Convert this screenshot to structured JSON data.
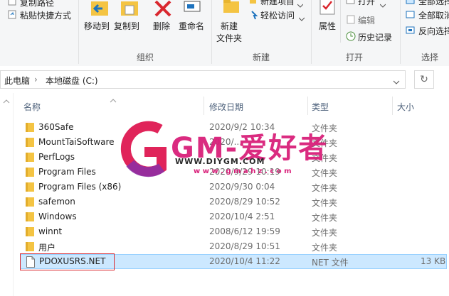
{
  "ribbon": {
    "copy_path": "复制路径",
    "paste_shortcut": "粘贴快捷方式",
    "move_to": "移动到",
    "copy_to": "复制到",
    "delete": "删除",
    "rename": "重命名",
    "new_folder_line1": "新建",
    "new_folder_line2": "文件夹",
    "new_item": "新建项目",
    "easy_access": "轻松访问",
    "properties": "属性",
    "open": "打开",
    "edit": "编辑",
    "history": "历史记录",
    "select_all": "全部选择",
    "select_none": "全部取消",
    "invert_selection": "反向选择",
    "groups": {
      "organize": "组织",
      "new": "新建",
      "open": "打开",
      "select": "选择"
    }
  },
  "address": {
    "root": "此电脑",
    "separator": "›",
    "current": "本地磁盘 (C:)"
  },
  "columns": {
    "name": "名称",
    "modified": "修改日期",
    "type": "类型",
    "size": "大小"
  },
  "files": [
    {
      "name": "360Safe",
      "modified": "2020/9/2 10:34",
      "type": "文件夹",
      "size": ""
    },
    {
      "name": "MountTaiSoftware",
      "modified": "2020/...",
      "type": "文件夹",
      "size": ""
    },
    {
      "name": "PerfLogs",
      "modified": "",
      "type": "文件夹",
      "size": ""
    },
    {
      "name": "Program Files",
      "modified": "2020/9/29 10:19",
      "type": "文件夹",
      "size": ""
    },
    {
      "name": "Program Files (x86)",
      "modified": "2020/9/30 0:04",
      "type": "文件夹",
      "size": ""
    },
    {
      "name": "safemon",
      "modified": "2020/8/29 10:52",
      "type": "文件夹",
      "size": ""
    },
    {
      "name": "Windows",
      "modified": "2020/10/4 2:51",
      "type": "文件夹",
      "size": ""
    },
    {
      "name": "winnt",
      "modified": "2008/6/12 19:59",
      "type": "文件夹",
      "size": ""
    },
    {
      "name": "用户",
      "modified": "2020/8/29 10:51",
      "type": "文件夹",
      "size": ""
    },
    {
      "name": "PDOXUSRS.NET",
      "modified": "2020/10/4 11:22",
      "type": "NET 文件",
      "size": "13 KB",
      "selected": true
    }
  ],
  "watermark": {
    "logo": "GM-爱好者",
    "url": "WWW.DIYGM.COM",
    "url2": "w w w . g m a h z . c o m"
  },
  "colors": {
    "accent": "#1e73be",
    "selection": "#cce8ff",
    "highlight_box": "#d9272e",
    "folder": "#f4c443"
  }
}
